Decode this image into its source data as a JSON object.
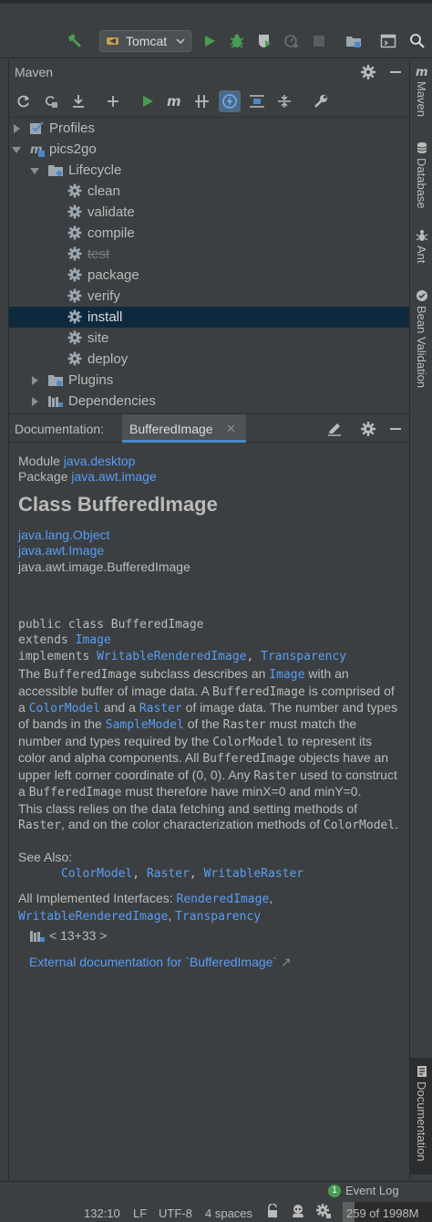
{
  "toolbar": {
    "run_config_label": "Tomcat",
    "icons": [
      "build-hammer-icon",
      "run-config-icon",
      "chevron-down-icon",
      "run-icon",
      "debug-icon",
      "coverage-icon",
      "profile-icon",
      "stop-icon",
      "project-structure-icon",
      "terminal-icon",
      "search-icon"
    ]
  },
  "maven": {
    "title": "Maven",
    "tools": [
      "reload-icon",
      "generate-sources-icon",
      "download-icon",
      "add-icon",
      "run-icon",
      "execute-goal-icon",
      "toggle-skip-tests-icon",
      "offline-icon",
      "show-dependencies-icon",
      "collapse-icon",
      "settings-wrench-icon"
    ],
    "tree": [
      {
        "label": "Profiles",
        "level": 0,
        "expanded": false
      },
      {
        "label": "pics2go",
        "level": 0,
        "expanded": true
      },
      {
        "label": "Lifecycle",
        "level": 1,
        "expanded": true
      },
      {
        "label": "clean",
        "level": 2
      },
      {
        "label": "validate",
        "level": 2
      },
      {
        "label": "compile",
        "level": 2
      },
      {
        "label": "test",
        "level": 2,
        "skipped": true
      },
      {
        "label": "package",
        "level": 2
      },
      {
        "label": "verify",
        "level": 2
      },
      {
        "label": "install",
        "level": 2,
        "selected": true
      },
      {
        "label": "site",
        "level": 2
      },
      {
        "label": "deploy",
        "level": 2
      },
      {
        "label": "Plugins",
        "level": 1,
        "expanded": false
      },
      {
        "label": "Dependencies",
        "level": 1,
        "expanded": false
      }
    ]
  },
  "side_tabs": {
    "maven": "Maven",
    "database": "Database",
    "ant": "Ant",
    "bean_validation": "Bean Validation",
    "documentation": "Documentation"
  },
  "doc": {
    "panel_title": "Documentation:",
    "tab_label": "BufferedImage",
    "tab_close": "✕",
    "module_label": "Module",
    "module_value": "java.desktop",
    "package_label": "Package",
    "package_value": "java.awt.image",
    "class_title": "Class BufferedImage",
    "hierarchy": [
      "java.lang.Object",
      "java.awt.Image",
      "java.awt.image.BufferedImage"
    ],
    "sig_line1": "public class BufferedImage",
    "sig_extends": "extends",
    "sig_extends_link": "Image",
    "sig_implements": "implements",
    "sig_impl_1": "WritableRenderedImage",
    "sig_comma": ",",
    "sig_impl_2": "Transparency",
    "d1": "The",
    "d2": "BufferedImage",
    "d3": "subclass describes an",
    "d4": "Image",
    "d5": "with an accessible buffer of image data. A",
    "d6": "BufferedImage",
    "d7": "is comprised of a",
    "d8": "ColorModel",
    "d9": "and a",
    "d10": "Raster",
    "d11": "of image data. The number and types of bands in the",
    "d12": "SampleModel",
    "d13": "of the",
    "d14": "Raster",
    "d15": "must match the number and types required by the",
    "d16": "ColorModel",
    "d17": "to represent its color and alpha components. All",
    "d18": "BufferedImage",
    "d19": "objects have an upper left corner coordinate of (0, 0). Any",
    "d20": "Raster",
    "d21": "used to construct a",
    "d22": "BufferedImage",
    "d23": "must therefore have minX=0 and minY=0.",
    "d24": "This class relies on the data fetching and setting methods of",
    "d25": "Raster",
    "d26": ", and on the color characterization methods of",
    "d27": "ColorModel",
    "d28": ".",
    "see_also_label": "See Also:",
    "see_also_links": [
      "ColorModel",
      "Raster",
      "WritableRaster"
    ],
    "impl_label": "All Implemented Interfaces:",
    "impl_links": [
      "RenderedImage",
      "WritableRenderedImage",
      "Transparency"
    ],
    "version": "< 13+33 >",
    "external_doc": "External documentation for `BufferedImage`",
    "external_arrow": "↗"
  },
  "status": {
    "event_log_badge": "1",
    "event_log": "Event Log",
    "position": "132:10",
    "line_sep": "LF",
    "encoding": "UTF-8",
    "indent": "4 spaces",
    "memory": "259 of 1998M",
    "memory_fraction": 0.13
  },
  "colors": {
    "background": "#3c3f41",
    "selection": "#0d293e",
    "link": "#589df6",
    "run_green": "#499c54",
    "accent_blue": "#4a88c7"
  }
}
